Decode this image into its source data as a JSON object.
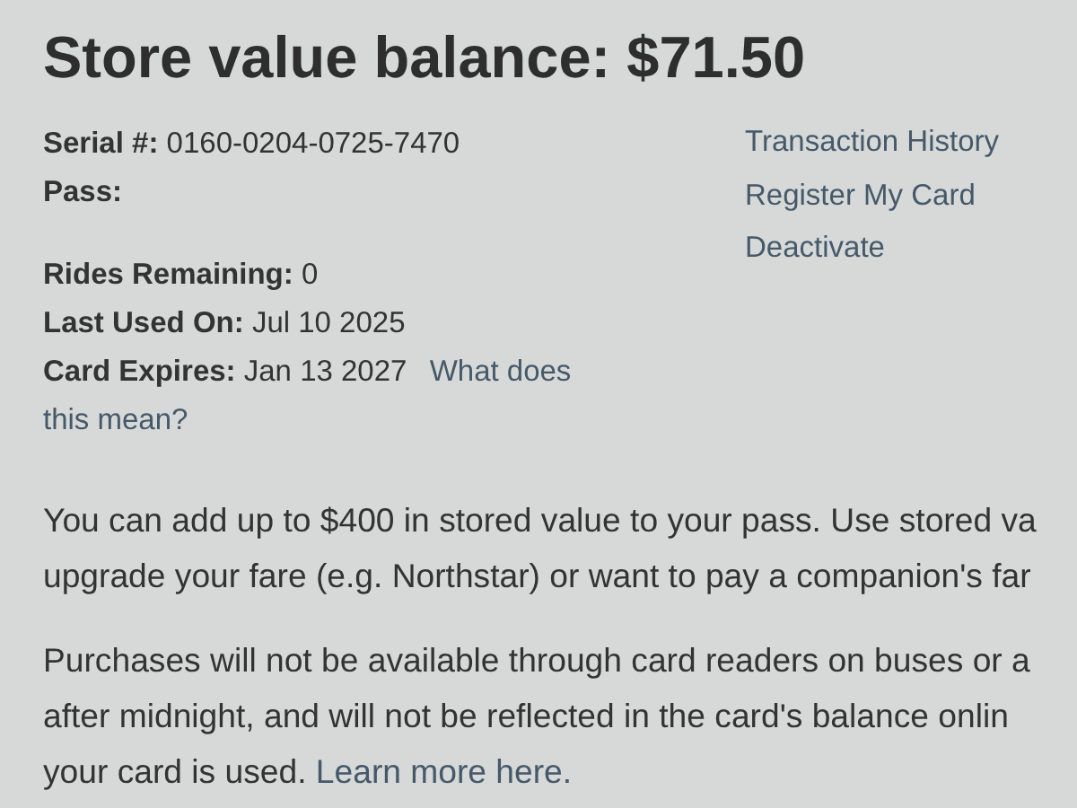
{
  "heading": "Store value balance: $71.50",
  "info_groups": [
    [
      {
        "label": "Serial #:",
        "value": "0160-0204-0725-7470"
      },
      {
        "label": "Pass:"
      }
    ],
    [
      {
        "label": "Rides Remaining:",
        "value": "0"
      },
      {
        "label": "Last Used On:",
        "value": "Jul 10 2025"
      },
      {
        "label": "Card Expires:",
        "value": "Jan 13 2027",
        "link_lines": [
          "What does",
          "this mean?"
        ]
      }
    ]
  ],
  "actions": [
    "Transaction History",
    "Register My Card",
    "Deactivate"
  ],
  "paragraphs": [
    [
      {
        "text": "You can add up to $400 in stored value to your pass. Use stored va"
      },
      {
        "text": "upgrade your fare (e.g. Northstar) or want to pay a companion's far"
      }
    ],
    [
      {
        "text": "Purchases will not be available through card readers on buses or a"
      },
      {
        "text": "after midnight, and will not be reflected in the card's balance onlin"
      },
      {
        "text": "your card is used. ",
        "link": "Learn more here."
      }
    ]
  ]
}
